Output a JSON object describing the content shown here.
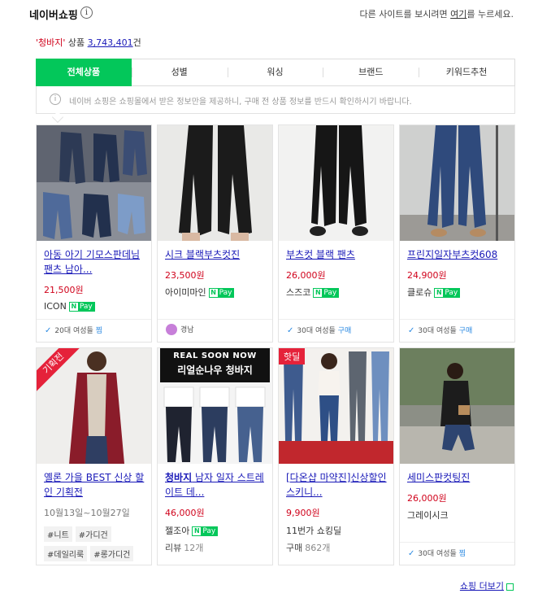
{
  "header": {
    "title": "네이버쇼핑",
    "info": "i",
    "other_pre": "다른 사이트를 보시려면 ",
    "other_link": "여기",
    "other_post": "를 누르세요."
  },
  "count": {
    "keyword": "'청바지'",
    "label": " 상품 ",
    "number": "3,743,401",
    "unit": "건"
  },
  "tabs": [
    "전체상품",
    "성별",
    "워싱",
    "브랜드",
    "키워드추천"
  ],
  "notice": {
    "icon": "i",
    "text": "네이버 쇼핑은 쇼핑몰에서 받은 정보만을 제공하니, 구매 전 상품 정보를 반드시 확인하시기 바랍니다."
  },
  "npay": {
    "n": "N",
    "pay": "Pay"
  },
  "products": [
    {
      "name": "아동 아기 기모스판데님 팬츠 남아...",
      "price": "21,500원",
      "shop": "ICON",
      "npay": true,
      "foot_age": "20대 여성들 ",
      "foot_action": "찜"
    },
    {
      "name": "시크 블랙부츠컷진",
      "price": "23,500원",
      "shop": "아이미마인",
      "npay": true,
      "foot_region": "경남"
    },
    {
      "name": "부츠컷 블랙 팬츠",
      "price": "26,000원",
      "shop": "스즈코",
      "npay": true,
      "foot_age": "30대 여성들 ",
      "foot_action": "구매"
    },
    {
      "name": "프린지일자부츠컷608",
      "price": "24,900원",
      "shop": "클로슈",
      "npay": true,
      "foot_age": "30대 여성들 ",
      "foot_action": "구매"
    },
    {
      "name": "옐론 가을 BEST 신상 할인 기획전",
      "ribbon": "기획전",
      "date": "10월13일~10월27일",
      "tags": [
        "#니트",
        "#가디건",
        "#데일리룩",
        "#롱가디건"
      ]
    },
    {
      "name_bold": "청바지",
      "name_rest": " 남자 일자 스트레이트 데...",
      "price": "46,000원",
      "shop": "젤조아",
      "npay": true,
      "review_label": "리뷰",
      "review_count": "12개",
      "banner_top": "REAL SOON NOW",
      "banner_sub": "리얼순나우 청바지"
    },
    {
      "name": "[다온샵 마약진]신상할인 스키니...",
      "price": "9,900원",
      "shop": "11번가 쇼킹딜",
      "hotdeal": "핫딜",
      "buy_label": "구매",
      "buy_count": "862개"
    },
    {
      "name": "세미스판컷팅진",
      "price": "26,000원",
      "shop": "그레이시크",
      "foot_age": "30대 여성들 ",
      "foot_action": "찜"
    }
  ],
  "more": "쇼핑 더보기"
}
